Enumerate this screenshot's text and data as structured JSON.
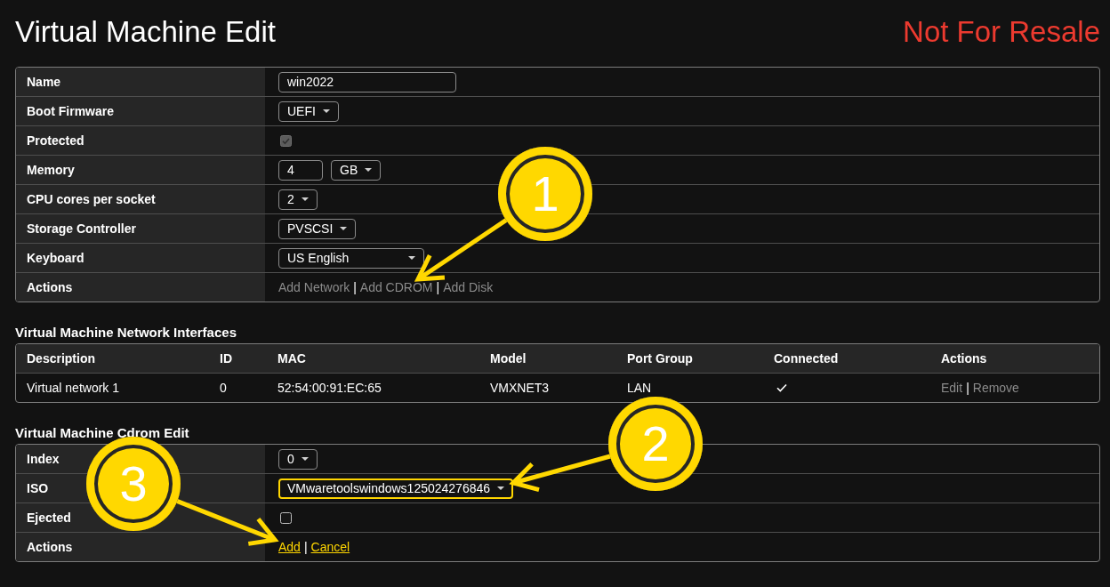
{
  "page": {
    "title": "Virtual Machine Edit",
    "notice": "Not For Resale"
  },
  "vm_form": {
    "rows": [
      {
        "label": "Name",
        "kind": "text",
        "value": "win2022",
        "highlighted": false
      },
      {
        "label": "Boot Firmware",
        "kind": "select",
        "value": "UEFI",
        "highlighted": false
      },
      {
        "label": "Protected",
        "kind": "checkbox",
        "checked": true,
        "disabled": true
      },
      {
        "label": "Memory",
        "kind": "number_unit",
        "value": "4",
        "unit": "GB",
        "highlighted": false
      },
      {
        "label": "CPU cores per socket",
        "kind": "select",
        "value": "2",
        "highlighted": false
      },
      {
        "label": "Storage Controller",
        "kind": "select",
        "value": "PVSCSI",
        "highlighted": false
      },
      {
        "label": "Keyboard",
        "kind": "select",
        "value": "US English",
        "highlighted": false
      },
      {
        "label": "Actions",
        "kind": "links",
        "items": [
          {
            "kind": "link",
            "text": "Add Network",
            "highlighted": false
          },
          {
            "kind": "separator",
            "text": "|"
          },
          {
            "kind": "link",
            "text": "Add CDROM",
            "highlighted": false
          },
          {
            "kind": "separator",
            "text": "|"
          },
          {
            "kind": "link",
            "text": "Add Disk",
            "highlighted": false
          }
        ]
      }
    ]
  },
  "network_interfaces": {
    "title": "Virtual Machine Network Interfaces",
    "columns": [
      "Description",
      "ID",
      "MAC",
      "Model",
      "Port Group",
      "Connected",
      "Actions"
    ],
    "rows": [
      {
        "description": "Virtual network 1",
        "id": "0",
        "mac": "52:54:00:91:EC:65",
        "model": "VMXNET3",
        "port_group": "LAN",
        "connected": true,
        "actions": [
          {
            "kind": "link",
            "text": "Edit",
            "highlighted": false
          },
          {
            "kind": "separator",
            "text": "|"
          },
          {
            "kind": "link",
            "text": "Remove",
            "highlighted": false
          }
        ]
      }
    ]
  },
  "cdrom_edit": {
    "title": "Virtual Machine Cdrom Edit",
    "rows": [
      {
        "label": "Index",
        "kind": "select",
        "value": "0",
        "highlighted": false
      },
      {
        "label": "ISO",
        "kind": "select",
        "value": "VMwaretoolswindows125024276846",
        "highlighted": true
      },
      {
        "label": "Ejected",
        "kind": "checkbox",
        "checked": false,
        "disabled": false
      },
      {
        "label": "Actions",
        "kind": "links",
        "items": [
          {
            "kind": "link",
            "text": "Add",
            "highlighted": true
          },
          {
            "kind": "separator",
            "text": "|"
          },
          {
            "kind": "link",
            "text": "Cancel",
            "highlighted": true
          }
        ]
      }
    ]
  },
  "callouts": [
    {
      "number": "1"
    },
    {
      "number": "2"
    },
    {
      "number": "3"
    }
  ]
}
